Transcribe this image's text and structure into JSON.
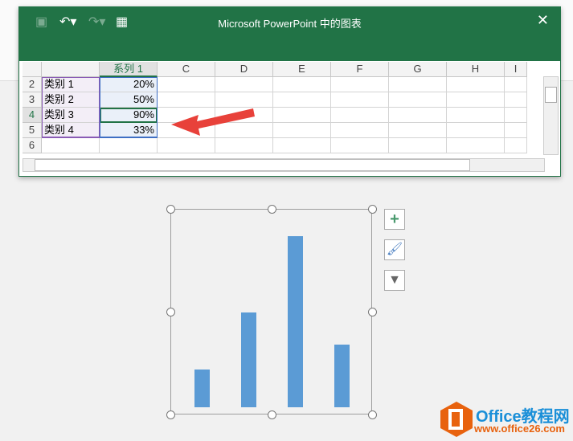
{
  "window": {
    "title": "Microsoft PowerPoint 中的图表",
    "close_label": "✕"
  },
  "toolbar": {
    "save_icon": "save-icon",
    "undo_icon": "undo-icon",
    "redo_icon": "redo-icon",
    "excel_icon": "edit-in-excel-icon"
  },
  "sheet": {
    "columns": [
      "系列 1",
      "C",
      "D",
      "E",
      "F",
      "G",
      "H",
      "I"
    ],
    "rows": [
      {
        "num": "2",
        "category": "类别 1",
        "value": "20%"
      },
      {
        "num": "3",
        "category": "类别 2",
        "value": "50%"
      },
      {
        "num": "4",
        "category": "类别 3",
        "value": "90%"
      },
      {
        "num": "5",
        "category": "类别 4",
        "value": "33%"
      },
      {
        "num": "6",
        "category": "",
        "value": ""
      }
    ]
  },
  "chart_data": {
    "type": "bar",
    "categories": [
      "类别 1",
      "类别 2",
      "类别 3",
      "类别 4"
    ],
    "series": [
      {
        "name": "系列 1",
        "values": [
          20,
          50,
          90,
          33
        ]
      }
    ],
    "ylim": [
      0,
      100
    ],
    "color": "#5b9bd5"
  },
  "side_buttons": [
    "chart-elements",
    "chart-styles",
    "chart-filters"
  ],
  "watermark": {
    "brand": "Office教程网",
    "url": "www.office26.com"
  },
  "colors": {
    "titlebar": "#217346",
    "bar": "#5b9bd5",
    "arrow": "#e8413a",
    "logo": "#e8620e"
  }
}
